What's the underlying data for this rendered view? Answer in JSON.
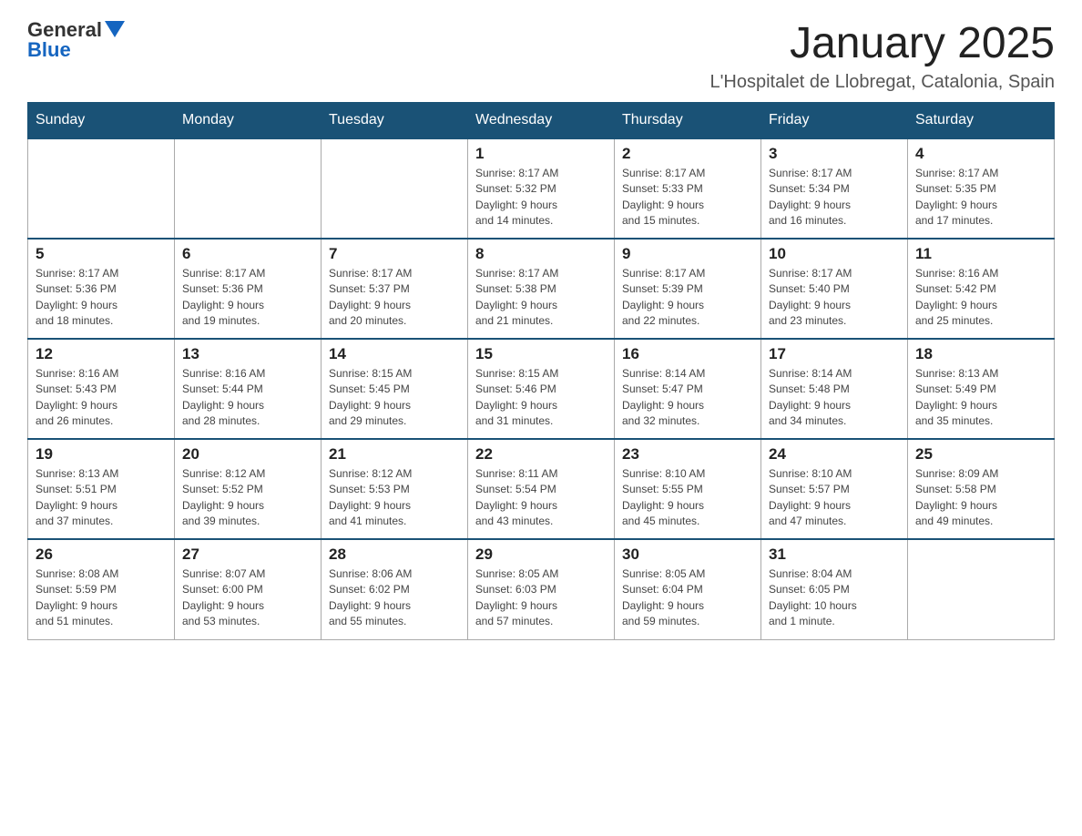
{
  "header": {
    "logo_text_general": "General",
    "logo_text_blue": "Blue",
    "month_title": "January 2025",
    "location": "L'Hospitalet de Llobregat, Catalonia, Spain"
  },
  "days_of_week": [
    "Sunday",
    "Monday",
    "Tuesday",
    "Wednesday",
    "Thursday",
    "Friday",
    "Saturday"
  ],
  "weeks": [
    [
      {
        "day": "",
        "info": ""
      },
      {
        "day": "",
        "info": ""
      },
      {
        "day": "",
        "info": ""
      },
      {
        "day": "1",
        "info": "Sunrise: 8:17 AM\nSunset: 5:32 PM\nDaylight: 9 hours\nand 14 minutes."
      },
      {
        "day": "2",
        "info": "Sunrise: 8:17 AM\nSunset: 5:33 PM\nDaylight: 9 hours\nand 15 minutes."
      },
      {
        "day": "3",
        "info": "Sunrise: 8:17 AM\nSunset: 5:34 PM\nDaylight: 9 hours\nand 16 minutes."
      },
      {
        "day": "4",
        "info": "Sunrise: 8:17 AM\nSunset: 5:35 PM\nDaylight: 9 hours\nand 17 minutes."
      }
    ],
    [
      {
        "day": "5",
        "info": "Sunrise: 8:17 AM\nSunset: 5:36 PM\nDaylight: 9 hours\nand 18 minutes."
      },
      {
        "day": "6",
        "info": "Sunrise: 8:17 AM\nSunset: 5:36 PM\nDaylight: 9 hours\nand 19 minutes."
      },
      {
        "day": "7",
        "info": "Sunrise: 8:17 AM\nSunset: 5:37 PM\nDaylight: 9 hours\nand 20 minutes."
      },
      {
        "day": "8",
        "info": "Sunrise: 8:17 AM\nSunset: 5:38 PM\nDaylight: 9 hours\nand 21 minutes."
      },
      {
        "day": "9",
        "info": "Sunrise: 8:17 AM\nSunset: 5:39 PM\nDaylight: 9 hours\nand 22 minutes."
      },
      {
        "day": "10",
        "info": "Sunrise: 8:17 AM\nSunset: 5:40 PM\nDaylight: 9 hours\nand 23 minutes."
      },
      {
        "day": "11",
        "info": "Sunrise: 8:16 AM\nSunset: 5:42 PM\nDaylight: 9 hours\nand 25 minutes."
      }
    ],
    [
      {
        "day": "12",
        "info": "Sunrise: 8:16 AM\nSunset: 5:43 PM\nDaylight: 9 hours\nand 26 minutes."
      },
      {
        "day": "13",
        "info": "Sunrise: 8:16 AM\nSunset: 5:44 PM\nDaylight: 9 hours\nand 28 minutes."
      },
      {
        "day": "14",
        "info": "Sunrise: 8:15 AM\nSunset: 5:45 PM\nDaylight: 9 hours\nand 29 minutes."
      },
      {
        "day": "15",
        "info": "Sunrise: 8:15 AM\nSunset: 5:46 PM\nDaylight: 9 hours\nand 31 minutes."
      },
      {
        "day": "16",
        "info": "Sunrise: 8:14 AM\nSunset: 5:47 PM\nDaylight: 9 hours\nand 32 minutes."
      },
      {
        "day": "17",
        "info": "Sunrise: 8:14 AM\nSunset: 5:48 PM\nDaylight: 9 hours\nand 34 minutes."
      },
      {
        "day": "18",
        "info": "Sunrise: 8:13 AM\nSunset: 5:49 PM\nDaylight: 9 hours\nand 35 minutes."
      }
    ],
    [
      {
        "day": "19",
        "info": "Sunrise: 8:13 AM\nSunset: 5:51 PM\nDaylight: 9 hours\nand 37 minutes."
      },
      {
        "day": "20",
        "info": "Sunrise: 8:12 AM\nSunset: 5:52 PM\nDaylight: 9 hours\nand 39 minutes."
      },
      {
        "day": "21",
        "info": "Sunrise: 8:12 AM\nSunset: 5:53 PM\nDaylight: 9 hours\nand 41 minutes."
      },
      {
        "day": "22",
        "info": "Sunrise: 8:11 AM\nSunset: 5:54 PM\nDaylight: 9 hours\nand 43 minutes."
      },
      {
        "day": "23",
        "info": "Sunrise: 8:10 AM\nSunset: 5:55 PM\nDaylight: 9 hours\nand 45 minutes."
      },
      {
        "day": "24",
        "info": "Sunrise: 8:10 AM\nSunset: 5:57 PM\nDaylight: 9 hours\nand 47 minutes."
      },
      {
        "day": "25",
        "info": "Sunrise: 8:09 AM\nSunset: 5:58 PM\nDaylight: 9 hours\nand 49 minutes."
      }
    ],
    [
      {
        "day": "26",
        "info": "Sunrise: 8:08 AM\nSunset: 5:59 PM\nDaylight: 9 hours\nand 51 minutes."
      },
      {
        "day": "27",
        "info": "Sunrise: 8:07 AM\nSunset: 6:00 PM\nDaylight: 9 hours\nand 53 minutes."
      },
      {
        "day": "28",
        "info": "Sunrise: 8:06 AM\nSunset: 6:02 PM\nDaylight: 9 hours\nand 55 minutes."
      },
      {
        "day": "29",
        "info": "Sunrise: 8:05 AM\nSunset: 6:03 PM\nDaylight: 9 hours\nand 57 minutes."
      },
      {
        "day": "30",
        "info": "Sunrise: 8:05 AM\nSunset: 6:04 PM\nDaylight: 9 hours\nand 59 minutes."
      },
      {
        "day": "31",
        "info": "Sunrise: 8:04 AM\nSunset: 6:05 PM\nDaylight: 10 hours\nand 1 minute."
      },
      {
        "day": "",
        "info": ""
      }
    ]
  ]
}
